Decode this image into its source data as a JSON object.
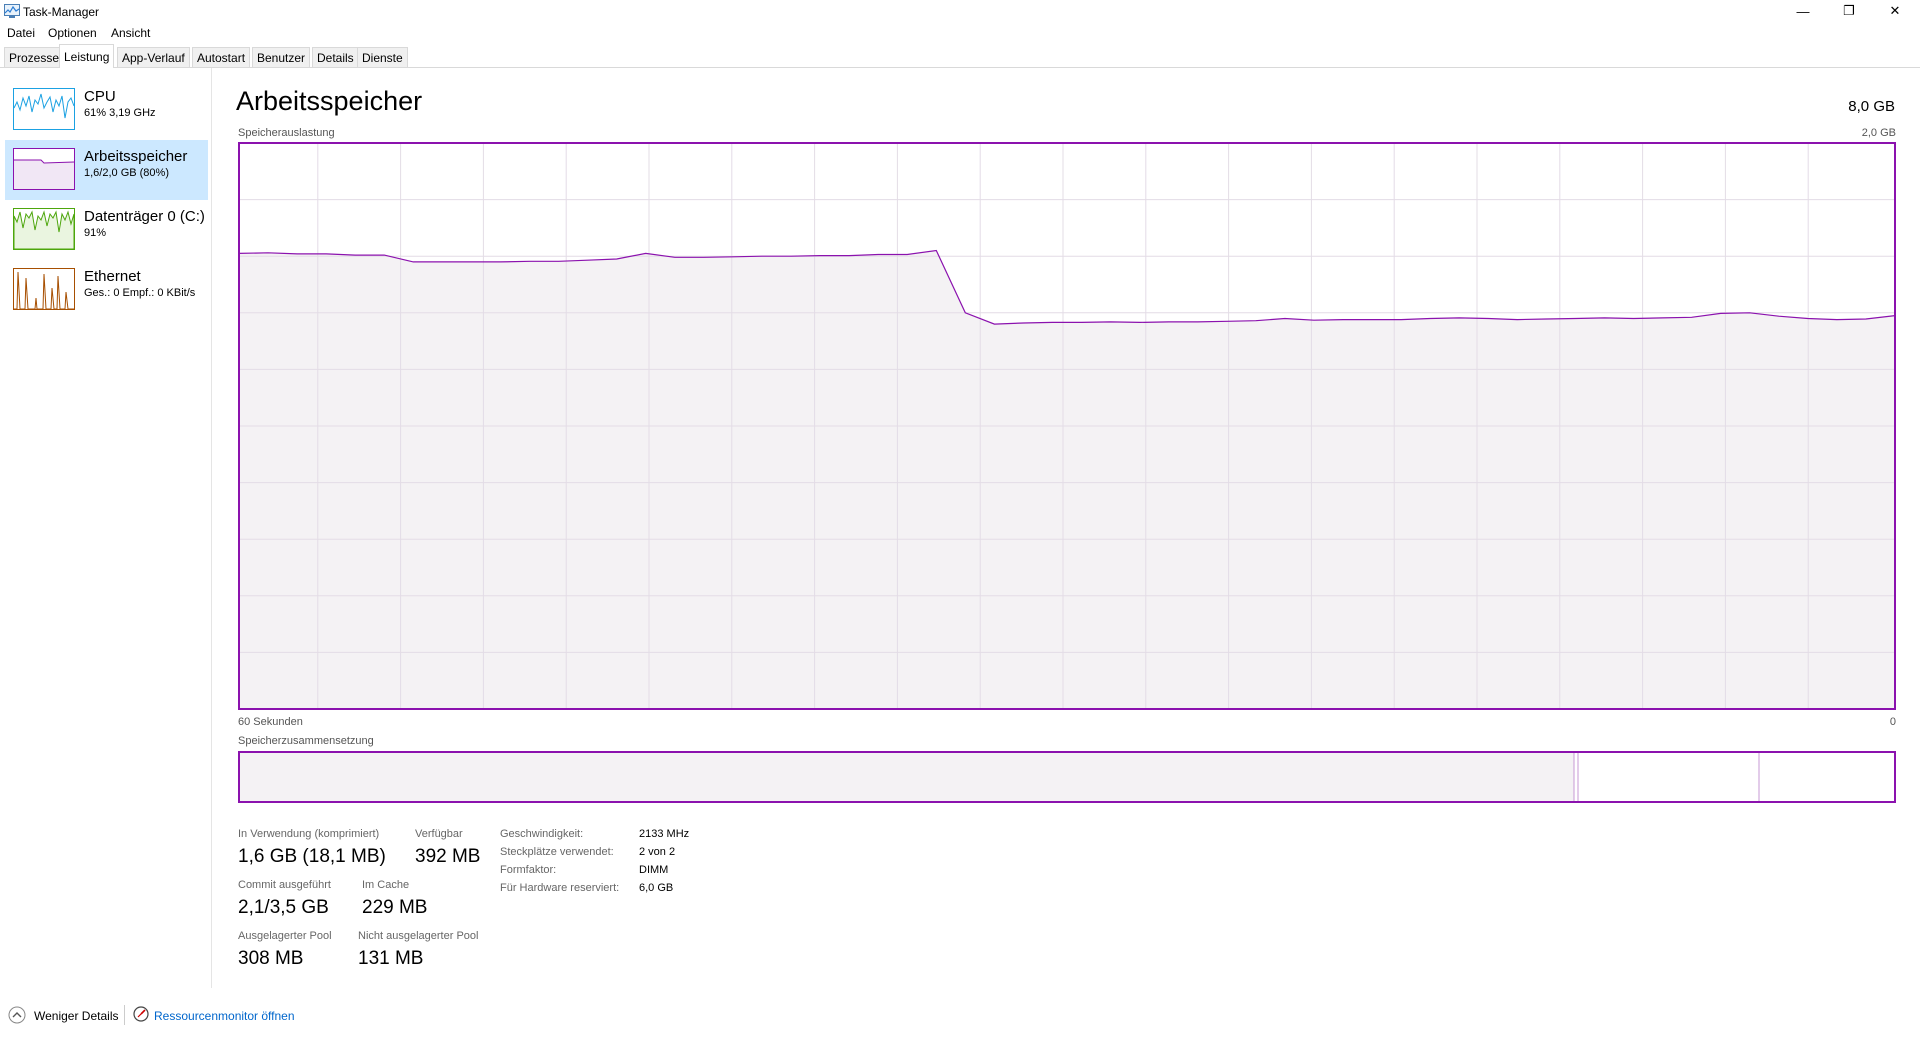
{
  "window": {
    "title": "Task-Manager",
    "minimize_glyph": "—",
    "maximize_glyph": "❐",
    "close_glyph": "✕"
  },
  "menu": [
    "Datei",
    "Optionen",
    "Ansicht"
  ],
  "tabs": [
    "Prozesse",
    "Leistung",
    "App-Verlauf",
    "Autostart",
    "Benutzer",
    "Details",
    "Dienste"
  ],
  "active_tab": "Leistung",
  "sidebar": {
    "items": [
      {
        "name": "CPU",
        "sub": "61% 3,19 GHz",
        "icon": "cpu-graph-icon",
        "color": "#1ba1e2"
      },
      {
        "name": "Arbeitsspeicher",
        "sub": "1,6/2,0 GB (80%)",
        "icon": "memory-graph-icon",
        "color": "#8b12ae"
      },
      {
        "name": "Datenträger 0 (C:)",
        "sub": "91%",
        "icon": "disk-graph-icon",
        "color": "#4da60c"
      },
      {
        "name": "Ethernet",
        "sub": "Ges.: 0 Empf.: 0 KBit/s",
        "icon": "ethernet-graph-icon",
        "color": "#a74f01"
      }
    ]
  },
  "main": {
    "title": "Arbeitsspeicher",
    "total": "8,0 GB",
    "graph_label": "Speicherauslastung",
    "graph_max": "2,0 GB",
    "graph_time_left": "60 Sekunden",
    "graph_time_right": "0",
    "composition_label": "Speicherzusammensetzung",
    "usage_series_percent": [
      80.5,
      80.6,
      80.4,
      80.4,
      80.2,
      80.2,
      79.0,
      79.0,
      79.0,
      79.0,
      79.1,
      79.1,
      79.3,
      79.5,
      80.5,
      79.8,
      79.8,
      79.9,
      80.0,
      80.0,
      80.1,
      80.1,
      80.3,
      80.3,
      81.0,
      70.0,
      68.0,
      68.2,
      68.3,
      68.3,
      68.4,
      68.3,
      68.4,
      68.4,
      68.5,
      68.6,
      69.0,
      68.7,
      68.8,
      68.8,
      68.8,
      69.0,
      69.1,
      69.0,
      68.8,
      68.9,
      69.0,
      69.1,
      69.0,
      69.1,
      69.2,
      69.9,
      70.0,
      69.4,
      69.0,
      68.8,
      68.9,
      69.5
    ],
    "colors": {
      "accent": "#8b12ae",
      "fill": "#f4f2f4",
      "grid": "#e3dce6"
    }
  },
  "stats": {
    "in_use_label": "In Verwendung (komprimiert)",
    "in_use_value": "1,6 GB (18,1 MB)",
    "available_label": "Verfügbar",
    "available_value": "392 MB",
    "committed_label": "Commit ausgeführt",
    "committed_value": "2,1/3,5 GB",
    "cached_label": "Im Cache",
    "cached_value": "229 MB",
    "paged_label": "Ausgelagerter Pool",
    "paged_value": "308 MB",
    "nonpaged_label": "Nicht ausgelagerter Pool",
    "nonpaged_value": "131 MB"
  },
  "specs": {
    "speed_label": "Geschwindigkeit:",
    "speed_value": "2133 MHz",
    "slots_label": "Steckplätze verwendet:",
    "slots_value": "2 von 2",
    "form_label": "Formfaktor:",
    "form_value": "DIMM",
    "reserved_label": "Für Hardware reserviert:",
    "reserved_value": "6,0 GB"
  },
  "footer": {
    "fewer_details": "Weniger Details",
    "resource_monitor": "Ressourcenmonitor öffnen"
  }
}
